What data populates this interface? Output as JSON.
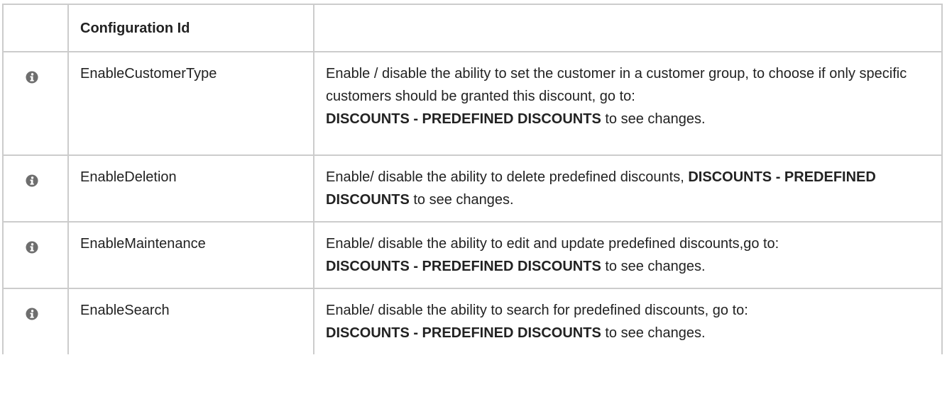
{
  "table": {
    "header": {
      "icon_col": "",
      "id_col": "Configuration Id",
      "desc_col": ""
    },
    "rows": [
      {
        "icon": "info-circle-icon",
        "id": "EnableCustomerType",
        "desc_text": "Enable / disable the  ability to set the customer in a customer group, to choose if only specific customers should be granted this discount, go to:",
        "desc_bold": "DISCOUNTS - PREDEFINED DISCOUNTS",
        "desc_suffix": "to see changes."
      },
      {
        "icon": "info-circle-icon",
        "id": "EnableDeletion",
        "desc_text": "Enable/ disable the ability to delete predefined discounts,",
        "desc_bold": "DISCOUNTS - PREDEFINED DISCOUNTS",
        "desc_suffix": "to see changes."
      },
      {
        "icon": "info-circle-icon",
        "id": "EnableMaintenance",
        "desc_text": "Enable/ disable the ability to edit and update predefined discounts,go to:",
        "desc_bold": "DISCOUNTS - PREDEFINED DISCOUNTS",
        "desc_suffix": "to see changes."
      },
      {
        "icon": "info-circle-icon",
        "id": "EnableSearch",
        "desc_text": "Enable/ disable the ability to search for predefined discounts, go to:",
        "desc_bold": "DISCOUNTS - PREDEFINED DISCOUNTS",
        "desc_suffix": "to see changes."
      }
    ]
  },
  "colors": {
    "border": "#cccccc",
    "text": "#222222",
    "icon": "#6e6e6e"
  }
}
